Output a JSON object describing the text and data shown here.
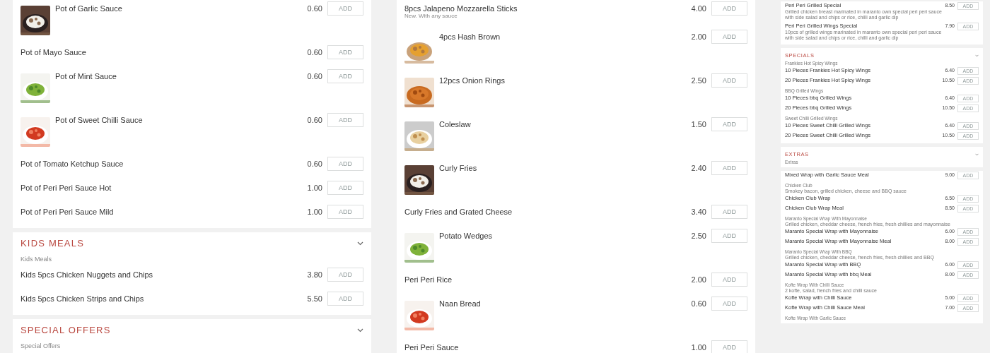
{
  "columns": [
    {
      "kind": "regular",
      "cards": [
        {
          "rows": [
            {
              "kind": "item",
              "name": "Pot of Garlic Sauce",
              "price": "0.60",
              "button": "ADD"
            },
            {
              "kind": "item",
              "name": "Pot of Mayo Sauce",
              "price": "0.60",
              "button": "ADD"
            },
            {
              "kind": "item",
              "name": "Pot of Mint Sauce",
              "price": "0.60",
              "button": "ADD"
            },
            {
              "kind": "item",
              "name": "Pot of Sweet Chilli Sauce",
              "price": "0.60",
              "button": "ADD"
            },
            {
              "kind": "item",
              "name": "Pot of Tomato Ketchup Sauce",
              "price": "0.60",
              "button": "ADD"
            },
            {
              "kind": "item",
              "name": "Pot of Peri Peri Sauce Hot",
              "price": "1.00",
              "button": "ADD"
            },
            {
              "kind": "item",
              "name": "Pot of Peri Peri Sauce Mild",
              "price": "1.00",
              "button": "ADD"
            }
          ]
        },
        {
          "header": {
            "title": "KIDS MEALS"
          },
          "rows": [
            {
              "kind": "category",
              "label": "Kids Meals"
            },
            {
              "kind": "item",
              "name": "Kids 5pcs Chicken Nuggets and Chips",
              "price": "3.80",
              "button": "ADD"
            },
            {
              "kind": "item",
              "name": "Kids 5pcs Chicken Strips and Chips",
              "price": "5.50",
              "button": "ADD"
            }
          ]
        },
        {
          "header": {
            "title": "SPECIAL OFFERS"
          },
          "rows": [
            {
              "kind": "category",
              "label": "Special Offers"
            }
          ]
        }
      ]
    },
    {
      "kind": "regular",
      "cards": [
        {
          "rows": [
            {
              "kind": "item",
              "name": "8pcs Jalapeno Mozzarella Sticks",
              "description": "New. With any sauce",
              "price": "4.00",
              "button": "ADD"
            },
            {
              "kind": "item",
              "name": "4pcs Hash Brown",
              "price": "2.00",
              "button": "ADD"
            },
            {
              "kind": "item",
              "name": "12pcs Onion Rings",
              "price": "2.50",
              "button": "ADD"
            },
            {
              "kind": "item",
              "name": "Coleslaw",
              "price": "1.50",
              "button": "ADD"
            },
            {
              "kind": "item",
              "name": "Curly Fries",
              "price": "2.40",
              "button": "ADD"
            },
            {
              "kind": "item",
              "name": "Curly Fries and Grated Cheese",
              "price": "3.40",
              "button": "ADD"
            },
            {
              "kind": "item",
              "name": "Potato Wedges",
              "price": "2.50",
              "button": "ADD"
            },
            {
              "kind": "item",
              "name": "Peri Peri Rice",
              "price": "2.00",
              "button": "ADD"
            },
            {
              "kind": "item",
              "name": "Naan Bread",
              "price": "0.60",
              "button": "ADD"
            },
            {
              "kind": "item",
              "name": "Peri Peri Sauce",
              "price": "1.00",
              "button": "ADD"
            }
          ]
        }
      ]
    },
    {
      "kind": "compact",
      "cards": [
        {
          "rows": [
            {
              "kind": "item",
              "name": "Peri Peri Grilled Special",
              "description": "Grilled chicken breast marinated in maranto own special peri peri sauce with side salad and chips or rice, chilli and garlic dip",
              "price": "8.50",
              "button": "ADD"
            },
            {
              "kind": "item",
              "name": "Peri Peri Grilled Wings Special",
              "description": "10pcs of grilled wings marinated in maranto own special peri peri sauce with side salad and chips or rice, chilli and garlic dip",
              "price": "7.90",
              "button": "ADD"
            }
          ]
        },
        {
          "header": {
            "title": "SPECIALS"
          },
          "rows": [
            {
              "kind": "category",
              "label": "Frankies Hot Spicy Wings"
            },
            {
              "kind": "item",
              "name": "10 Pieces Frankies Hot Spicy Wings",
              "price": "6.40",
              "button": "ADD"
            },
            {
              "kind": "item",
              "name": "20 Pieces Frankies Hot Spicy Wings",
              "price": "10.50",
              "button": "ADD"
            },
            {
              "kind": "category",
              "label": "BBQ Grilled Wings"
            },
            {
              "kind": "item",
              "name": "10 Pieces bbq Grilled Wings",
              "price": "6.40",
              "button": "ADD"
            },
            {
              "kind": "item",
              "name": "20 Pieces bbq Grilled Wings",
              "price": "10.50",
              "button": "ADD"
            },
            {
              "kind": "category",
              "label": "Sweet Chilli Grilled Wings"
            },
            {
              "kind": "item",
              "name": "10 Pieces Sweet Chilli Grilled Wings",
              "price": "6.40",
              "button": "ADD"
            },
            {
              "kind": "item",
              "name": "20 Pieces Sweet Chilli Grilled Wings",
              "price": "10.50",
              "button": "ADD"
            }
          ]
        },
        {
          "header": {
            "title": "EXTRAS"
          },
          "rows": [
            {
              "kind": "category",
              "label": "Extras"
            }
          ]
        },
        {
          "rows": [
            {
              "kind": "item",
              "name": "Mixed Wrap with Garlic Sauce Meal",
              "price": "9.00",
              "button": "ADD"
            },
            {
              "kind": "category",
              "label": "Chicken Club",
              "description": "Smokey bacon, grilled chicken, cheese and BBQ sauce"
            },
            {
              "kind": "item",
              "name": "Chicken Club Wrap",
              "price": "6.50",
              "button": "ADD"
            },
            {
              "kind": "item",
              "name": "Chicken Club Wrap Meal",
              "price": "8.50",
              "button": "ADD"
            },
            {
              "kind": "category",
              "label": "Maranto Special Wrap With Mayonnaise",
              "description": "Grilled chicken, cheddar cheese, french fries, fresh chillies and mayonnaise"
            },
            {
              "kind": "item",
              "name": "Maranto Special Wrap with Mayonnaise",
              "price": "6.00",
              "button": "ADD"
            },
            {
              "kind": "item",
              "name": "Maranto Special Wrap with Mayonnaise Meal",
              "price": "8.00",
              "button": "ADD"
            },
            {
              "kind": "category",
              "label": "Maranto Special Wrap With BBQ",
              "description": "Grilled chicken, cheddar cheese, french fries, fresh chillies and BBQ"
            },
            {
              "kind": "item",
              "name": "Maranto Special Wrap with BBQ",
              "price": "6.00",
              "button": "ADD"
            },
            {
              "kind": "item",
              "name": "Maranto Special Wrap with bbq Meal",
              "price": "8.00",
              "button": "ADD"
            },
            {
              "kind": "category",
              "label": "Kofte Wrap With Chilli Sauce",
              "description": "2 kofte, salad, french fries and chilli sauce"
            },
            {
              "kind": "item",
              "name": "Kofte Wrap with Chilli Sauce",
              "price": "5.00",
              "button": "ADD"
            },
            {
              "kind": "item",
              "name": "Kofte Wrap with Chilli Sauce Meal",
              "price": "7.00",
              "button": "ADD"
            },
            {
              "kind": "category",
              "label": "Kofte Wrap With Garlic Sauce"
            }
          ]
        }
      ]
    }
  ]
}
